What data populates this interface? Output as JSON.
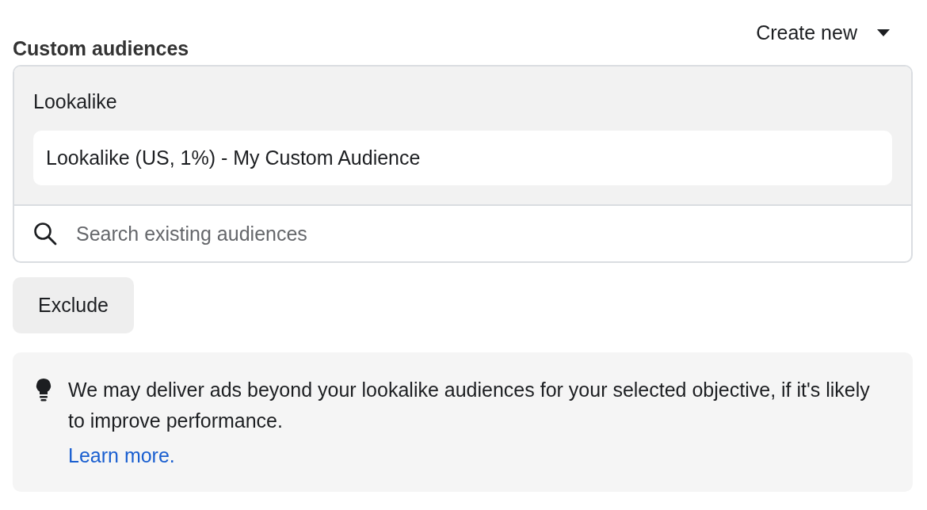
{
  "header": {
    "title": "Custom audiences",
    "create_button": "Create new"
  },
  "audience_box": {
    "group_label": "Lookalike",
    "selected_audiences": [
      "Lookalike (US, 1%) - My Custom Audience"
    ],
    "search": {
      "placeholder": "Search existing audiences"
    }
  },
  "exclude_button": "Exclude",
  "notice": {
    "text": "We may deliver ads beyond your lookalike audiences for your selected objective, if it's likely to improve performance.",
    "link": "Learn more."
  }
}
